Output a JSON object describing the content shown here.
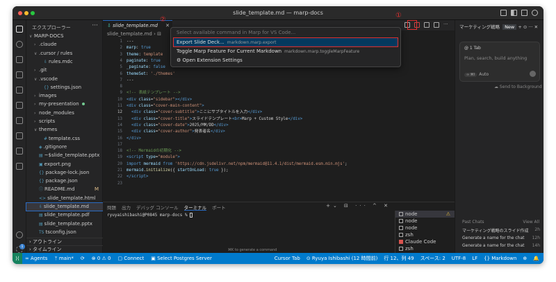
{
  "window": {
    "title": "slide_template.md — marp-docs"
  },
  "sidebar": {
    "header": "エクスプローラー",
    "tree": [
      {
        "label": "MARP-DOCS",
        "chev": "∨",
        "indent": 0
      },
      {
        "label": ".claude",
        "chev": "›",
        "indent": 1
      },
      {
        "label": ".cursor / rules",
        "chev": "∨",
        "indent": 1
      },
      {
        "label": "rules.mdc",
        "chev": "",
        "indent": 2,
        "icon": "⇩"
      },
      {
        "label": ".git",
        "chev": "›",
        "indent": 1
      },
      {
        "label": ".vscode",
        "chev": "∨",
        "indent": 1
      },
      {
        "label": "settings.json",
        "chev": "",
        "indent": 2,
        "icon": "{}"
      },
      {
        "label": "images",
        "chev": "›",
        "indent": 1
      },
      {
        "label": "my-presentation",
        "chev": "›",
        "indent": 1,
        "dot": true
      },
      {
        "label": "node_modules",
        "chev": "›",
        "indent": 1
      },
      {
        "label": "scripts",
        "chev": "›",
        "indent": 1
      },
      {
        "label": "themes",
        "chev": "∨",
        "indent": 1
      },
      {
        "label": "template.css",
        "chev": "",
        "indent": 2,
        "icon": "#"
      },
      {
        "label": ".gitignore",
        "chev": "",
        "indent": 1,
        "icon": "◈"
      },
      {
        "label": "~$slide_template.pptx",
        "chev": "",
        "indent": 1,
        "icon": "▤"
      },
      {
        "label": "export.png",
        "chev": "",
        "indent": 1,
        "icon": "▣"
      },
      {
        "label": "package-lock.json",
        "chev": "",
        "indent": 1,
        "icon": "{}"
      },
      {
        "label": "package.json",
        "chev": "",
        "indent": 1,
        "icon": "{}"
      },
      {
        "label": "README.md",
        "chev": "",
        "indent": 1,
        "icon": "ⓘ",
        "badge": "M"
      },
      {
        "label": "slide_template.html",
        "chev": "",
        "indent": 1,
        "icon": "<>"
      },
      {
        "label": "slide_template.md",
        "chev": "",
        "indent": 1,
        "icon": "⇩",
        "selected": true
      },
      {
        "label": "slide_template.pdf",
        "chev": "",
        "indent": 1,
        "icon": "▤"
      },
      {
        "label": "slide_template.pptx",
        "chev": "",
        "indent": 1,
        "icon": "▤"
      },
      {
        "label": "tsconfig.json",
        "chev": "",
        "indent": 1,
        "icon": "TS"
      }
    ],
    "outline": "アウトライン",
    "timeline": "タイムライン"
  },
  "editor": {
    "tab_label": "slide_template.md",
    "breadcrumb": "slide_template.md › ⊟"
  },
  "palette": {
    "placeholder": "Select available command in Marp for VS Code...",
    "items": [
      {
        "label": "Export Slide Deck...",
        "id": "markdown.marp.export",
        "selected": true
      },
      {
        "label": "Toggle Marp Feature For Current Markdown",
        "id": "markdown.marp.toggleMarpFeature"
      },
      {
        "label": "Open Extension Settings",
        "id": "",
        "gear": true
      }
    ]
  },
  "annotations": {
    "one": "①",
    "two": "②"
  },
  "panel": {
    "tabs": [
      "問題",
      "出力",
      "デバッグ コンソール",
      "ターミナル",
      "ポート"
    ],
    "prompt": "ryuyaishibashi@P0845 marp-docs % ",
    "hint": "⌘K to generate a command",
    "terminals": [
      {
        "label": "node",
        "warn": "⚠",
        "selected": true
      },
      {
        "label": "node"
      },
      {
        "label": "node"
      },
      {
        "label": "zsh"
      },
      {
        "label": "Claude Code",
        "red": true
      },
      {
        "label": "zsh"
      }
    ]
  },
  "chat": {
    "title": "マーケティング戦略",
    "new_label": "New",
    "tab_count": "1 Tab",
    "placeholder": "Plan, search, build anything",
    "pill": "∞ ⌘I",
    "mode": "Auto",
    "background": "Send to Background",
    "past_header": "Past Chats",
    "view_all": "View All",
    "past": [
      {
        "title": "マーケティング戦略のスライド作成",
        "age": "2h"
      },
      {
        "title": "Generate a name for the chat",
        "age": "12h"
      },
      {
        "title": "Generate a name for the chat",
        "age": "14h"
      }
    ]
  },
  "statusbar": {
    "left": [
      "∞ Agents",
      "ᛘ main*",
      "⟳",
      "⊗ 0 ⚠ 0",
      "▢ Connect",
      "▣ Select Postgres Server"
    ],
    "right": [
      "Cursor Tab",
      "⊙ Ryuya Ishibashi (12 時間前)",
      "行 12、列 49",
      "スペース: 2",
      "UTF-8",
      "LF",
      "{} Markdown",
      "⊕",
      "🔔"
    ]
  }
}
